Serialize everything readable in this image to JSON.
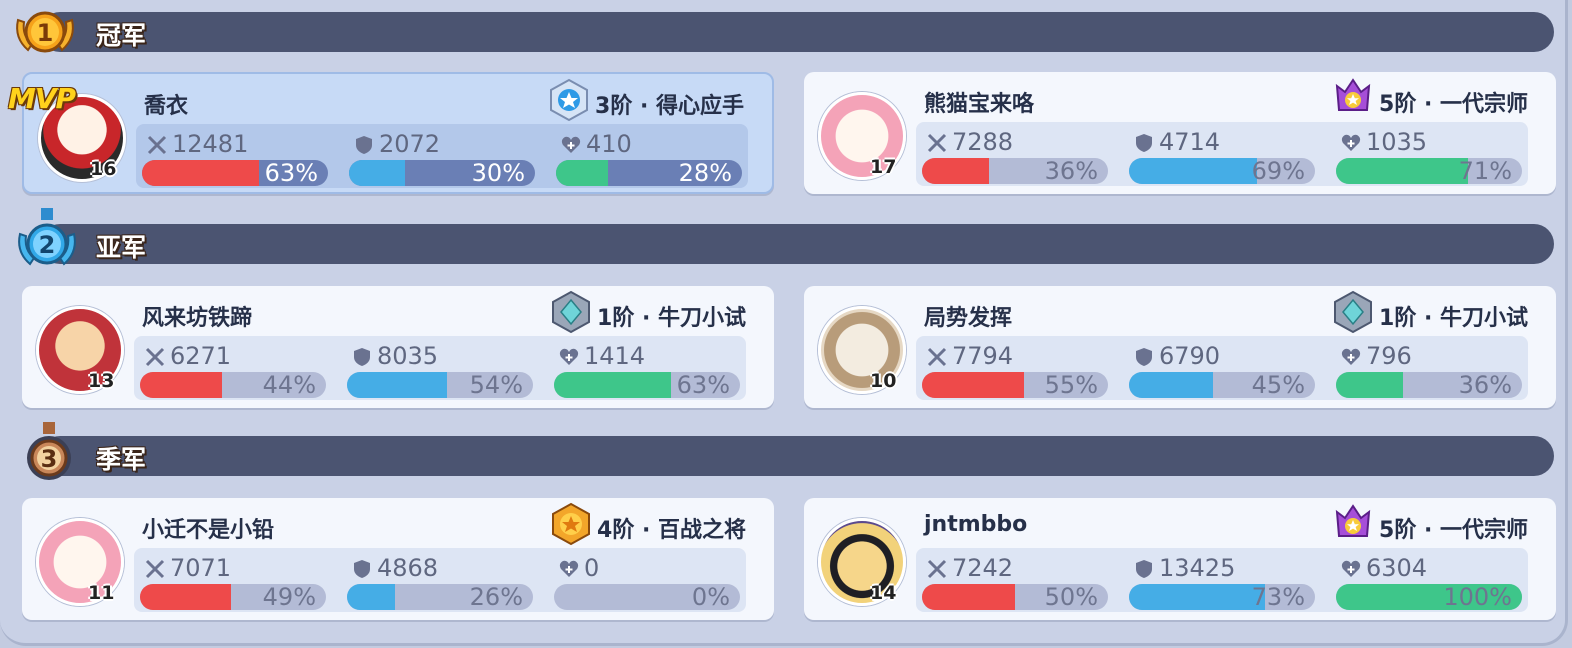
{
  "groups": [
    {
      "title": "冠军",
      "medal": "gold-medal-1",
      "medal_number": "1",
      "medal_color": "#f2a21a",
      "players": [
        {
          "name": "喬衣",
          "level": "16",
          "mvp": "MVP",
          "rank": "3阶 · 得心应手",
          "rank_icon": "blue-star-badge",
          "attack": "12481",
          "attack_pct": "63%",
          "attack_frac": 0.63,
          "defense": "2072",
          "defense_pct": "30%",
          "defense_frac": 0.3,
          "heal": "410",
          "heal_pct": "28%",
          "heal_frac": 0.28
        },
        {
          "name": "熊猫宝来咯",
          "level": "17",
          "rank": "5阶 · 一代宗师",
          "rank_icon": "purple-crown-badge",
          "attack": "7288",
          "attack_pct": "36%",
          "attack_frac": 0.36,
          "defense": "4714",
          "defense_pct": "69%",
          "defense_frac": 0.69,
          "heal": "1035",
          "heal_pct": "71%",
          "heal_frac": 0.71
        }
      ]
    },
    {
      "title": "亚军",
      "medal": "silver-medal-2",
      "medal_number": "2",
      "medal_color": "#31a8e8",
      "players": [
        {
          "name": "风来坊铁蹄",
          "level": "13",
          "rank": "1阶 · 牛刀小试",
          "rank_icon": "teal-diamond-badge",
          "attack": "6271",
          "attack_pct": "44%",
          "attack_frac": 0.44,
          "defense": "8035",
          "defense_pct": "54%",
          "defense_frac": 0.54,
          "heal": "1414",
          "heal_pct": "63%",
          "heal_frac": 0.63
        },
        {
          "name": "局势发挥",
          "level": "10",
          "rank": "1阶 · 牛刀小试",
          "rank_icon": "teal-diamond-badge",
          "attack": "7794",
          "attack_pct": "55%",
          "attack_frac": 0.55,
          "defense": "6790",
          "defense_pct": "45%",
          "defense_frac": 0.45,
          "heal": "796",
          "heal_pct": "36%",
          "heal_frac": 0.36
        }
      ]
    },
    {
      "title": "季军",
      "medal": "bronze-medal-3",
      "medal_number": "3",
      "medal_color": "#c9875a",
      "players": [
        {
          "name": "小迁不是小铅",
          "level": "11",
          "rank": "4阶 · 百战之将",
          "rank_icon": "gold-star-badge",
          "attack": "7071",
          "attack_pct": "49%",
          "attack_frac": 0.49,
          "defense": "4868",
          "defense_pct": "26%",
          "defense_frac": 0.26,
          "heal": "0",
          "heal_pct": "0%",
          "heal_frac": 0.0
        },
        {
          "name": "jntmbbo",
          "level": "14",
          "rank": "5阶 · 一代宗师",
          "rank_icon": "purple-crown-badge",
          "attack": "7242",
          "attack_pct": "50%",
          "attack_frac": 0.5,
          "defense": "13425",
          "defense_pct": "73%",
          "defense_frac": 0.73,
          "heal": "6304",
          "heal_pct": "100%",
          "heal_frac": 1.0
        }
      ]
    }
  ],
  "colors": {
    "attack": "#ee4a4a",
    "defense": "#45ade6",
    "heal": "#3ec68a",
    "band": "#4b5471"
  }
}
